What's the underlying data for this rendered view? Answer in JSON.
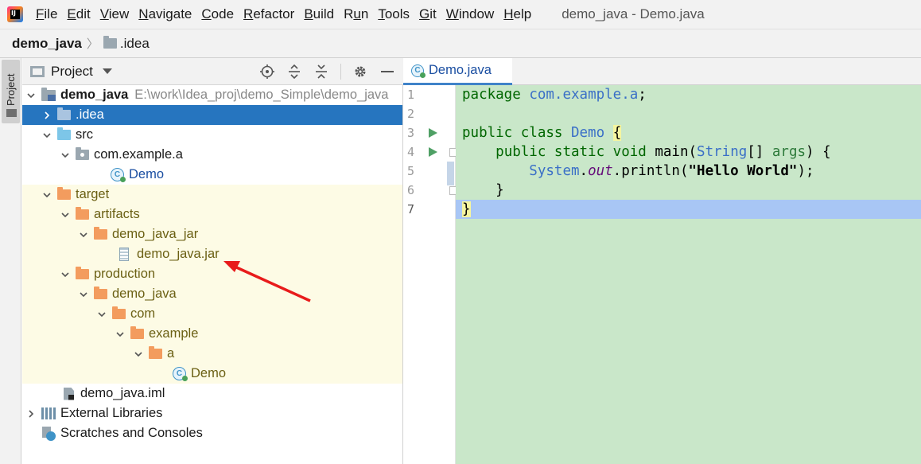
{
  "menubar": {
    "items": [
      {
        "label": "File",
        "mnemonic": "F"
      },
      {
        "label": "Edit",
        "mnemonic": "E"
      },
      {
        "label": "View",
        "mnemonic": "V"
      },
      {
        "label": "Navigate",
        "mnemonic": "N"
      },
      {
        "label": "Code",
        "mnemonic": "C"
      },
      {
        "label": "Refactor",
        "mnemonic": "R"
      },
      {
        "label": "Build",
        "mnemonic": "B"
      },
      {
        "label": "Run",
        "mnemonic": "u"
      },
      {
        "label": "Tools",
        "mnemonic": "T"
      },
      {
        "label": "Git",
        "mnemonic": "G"
      },
      {
        "label": "Window",
        "mnemonic": "W"
      },
      {
        "label": "Help",
        "mnemonic": "H"
      }
    ],
    "window_title": "demo_java - Demo.java"
  },
  "breadcrumb": {
    "project": "demo_java",
    "folder": ".idea"
  },
  "side_strip": {
    "tab_label": "Project"
  },
  "project_panel": {
    "title": "Project",
    "tree": [
      {
        "label": "demo_java",
        "path": "E:\\work\\Idea_proj\\demo_Simple\\demo_java"
      },
      {
        "label": ".idea"
      },
      {
        "label": "src"
      },
      {
        "label": "com.example.a"
      },
      {
        "label": "Demo"
      },
      {
        "label": "target"
      },
      {
        "label": "artifacts"
      },
      {
        "label": "demo_java_jar"
      },
      {
        "label": "demo_java.jar"
      },
      {
        "label": "production"
      },
      {
        "label": "demo_java"
      },
      {
        "label": "com"
      },
      {
        "label": "example"
      },
      {
        "label": "a"
      },
      {
        "label": "Demo"
      },
      {
        "label": "demo_java.iml"
      },
      {
        "label": "External Libraries"
      },
      {
        "label": "Scratches and Consoles"
      }
    ]
  },
  "editor": {
    "tab_label": "Demo.java",
    "line_numbers": [
      "1",
      "2",
      "3",
      "4",
      "5",
      "6",
      "7"
    ],
    "code": {
      "l1_kw": "package",
      "l1_pkg": "com.example.a",
      "l1_semi": ";",
      "l3_kw": "public class",
      "l3_name": "Demo",
      "l3_brace": "{",
      "l4_kw": "public static void",
      "l4_method": "main(",
      "l4_type": "String",
      "l4_arr": "[] ",
      "l4_param": "args",
      "l4_end": ") {",
      "l5_cls": "System",
      "l5_dot": ".",
      "l5_field": "out",
      "l5_call": ".println(",
      "l5_str": "\"Hello World\"",
      "l5_end": ");",
      "l6": "}",
      "l7": "}"
    }
  },
  "colors": {
    "selection": "#2675bf",
    "code_background": "#c9e7c9",
    "current_line": "#a8c6f5",
    "excluded_folder_bg": "#fdfbe5",
    "annotation_arrow": "#e81b1b"
  }
}
